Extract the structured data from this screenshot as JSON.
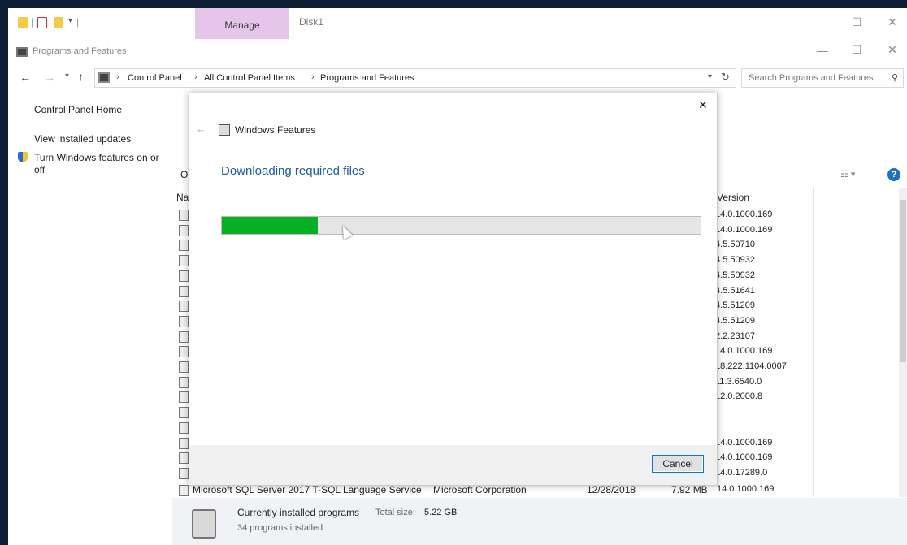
{
  "ribbon": {
    "manage_tab": "Manage",
    "disk_tab": "Disk1"
  },
  "window": {
    "title": "Programs and Features"
  },
  "address": {
    "crumbs": [
      "Control Panel",
      "All Control Panel Items",
      "Programs and Features"
    ],
    "search_placeholder": "Search Programs and Features"
  },
  "left_pane": {
    "home": "Control Panel Home",
    "updates": "View installed updates",
    "features": "Turn Windows features on or off"
  },
  "list": {
    "toolbar_prefix": "O",
    "name_header_prefix": "Na",
    "version_header": "Version",
    "versions": [
      "14.0.1000.169",
      "14.0.1000.169",
      "4.5.50710",
      "4.5.50932",
      "4.5.50932",
      "4.5.51641",
      "4.5.51209",
      "4.5.51209",
      "2.2.23107",
      "14.0.1000.169",
      "18.222.1104.0007",
      "11.3.6540.0",
      "12.0.2000.8",
      "",
      "",
      "14.0.1000.169",
      "14.0.1000.169",
      "14.0.17289.0"
    ],
    "last_row": {
      "name": "Microsoft SQL Server 2017 T-SQL Language Service",
      "publisher": "Microsoft Corporation",
      "installed": "12/28/2018",
      "size": "7.92 MB",
      "version": "14.0.1000.169"
    }
  },
  "status": {
    "title": "Currently installed programs",
    "total_label": "Total size:",
    "total_value": "5.22 GB",
    "count": "34 programs installed"
  },
  "dialog": {
    "title": "Windows Features",
    "heading": "Downloading required files",
    "progress": 0.2,
    "cancel_label": "Cancel"
  },
  "colors": {
    "accent_blue": "#1e73be",
    "progress_green": "#06b025",
    "manage_tab": "#e5c6ea"
  }
}
